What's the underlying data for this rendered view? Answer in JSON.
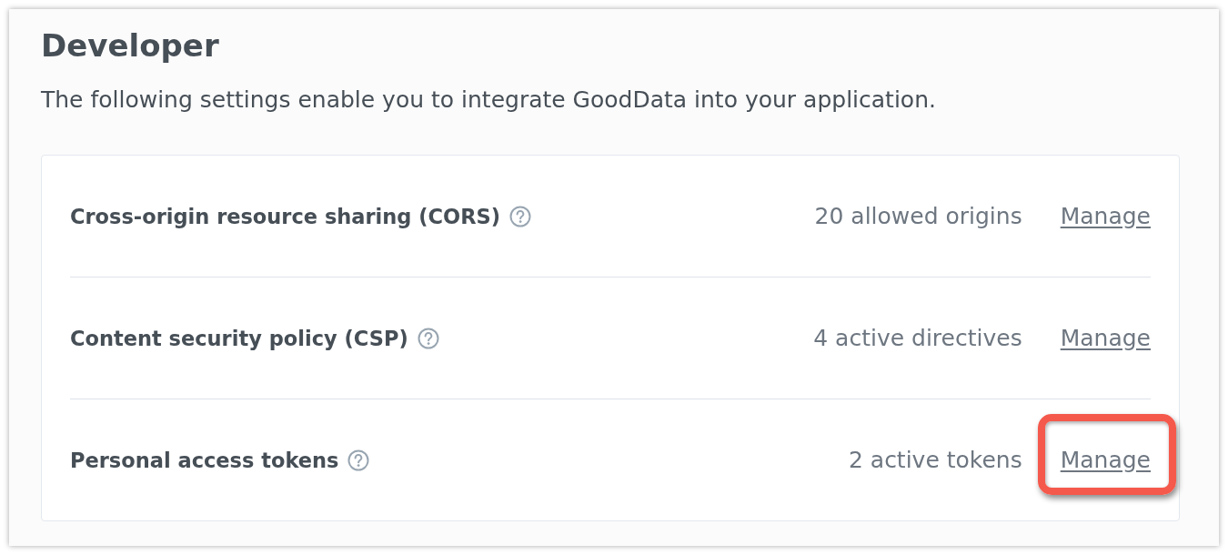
{
  "page": {
    "title": "Developer",
    "description": "The following settings enable you to integrate GoodData into your application."
  },
  "rows": [
    {
      "label": "Cross-origin resource sharing (CORS)",
      "summary": "20 allowed origins",
      "action": "Manage",
      "highlighted": false
    },
    {
      "label": "Content security policy (CSP)",
      "summary": "4 active directives",
      "action": "Manage",
      "highlighted": false
    },
    {
      "label": "Personal access tokens",
      "summary": "2 active tokens",
      "action": "Manage",
      "highlighted": true
    }
  ]
}
